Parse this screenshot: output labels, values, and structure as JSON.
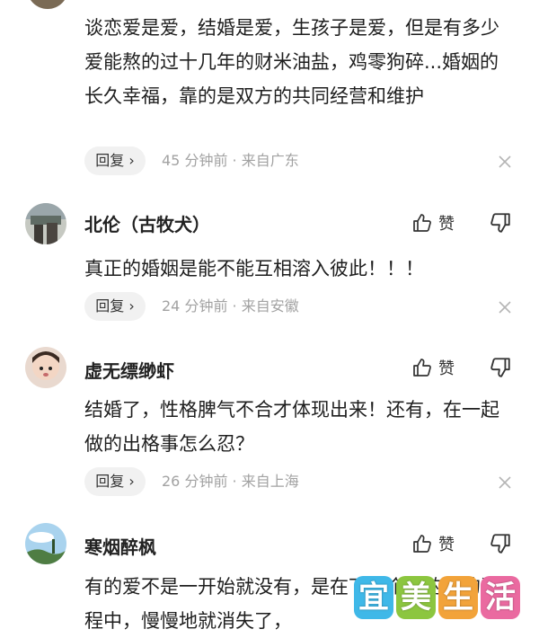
{
  "comments": [
    {
      "text": "谈恋爱是爱，结婚是爱，生孩子是爱，但是有多少爱能熬的过十几年的财米油盐，鸡零狗碎...婚姻的长久幸福，靠的是双方的共同经营和维护",
      "reply_label": "回复 ›",
      "meta": "45 分钟前 · 来自广东"
    },
    {
      "name": "北伦（古牧犬）",
      "like_label": "赞",
      "text": "真正的婚姻是能不能互相溶入彼此！！！",
      "reply_label": "回复 ›",
      "meta": "24 分钟前 · 来自安徽"
    },
    {
      "name": "虚无缥缈虾",
      "like_label": "赞",
      "text": "结婚了，性格脾气不合才体现出来！还有，在一起做的出格事怎么忍？",
      "reply_label": "回复 ›",
      "meta": "26 分钟前 · 来自上海"
    },
    {
      "name": "寒烟醉枫",
      "like_label": "赞",
      "text": "有的爱不是一开始就没有，是在下一个生的婚的过程中，慢慢地就消失了，"
    }
  ],
  "watermark": [
    "宜",
    "美",
    "生",
    "活"
  ],
  "colors": {
    "meta": "#a2a2a2",
    "reply_bg": "#f1f1f1",
    "watermark": [
      "#3fb8e8",
      "#8cc63f",
      "#f2a33a",
      "#ea6aa0"
    ]
  }
}
